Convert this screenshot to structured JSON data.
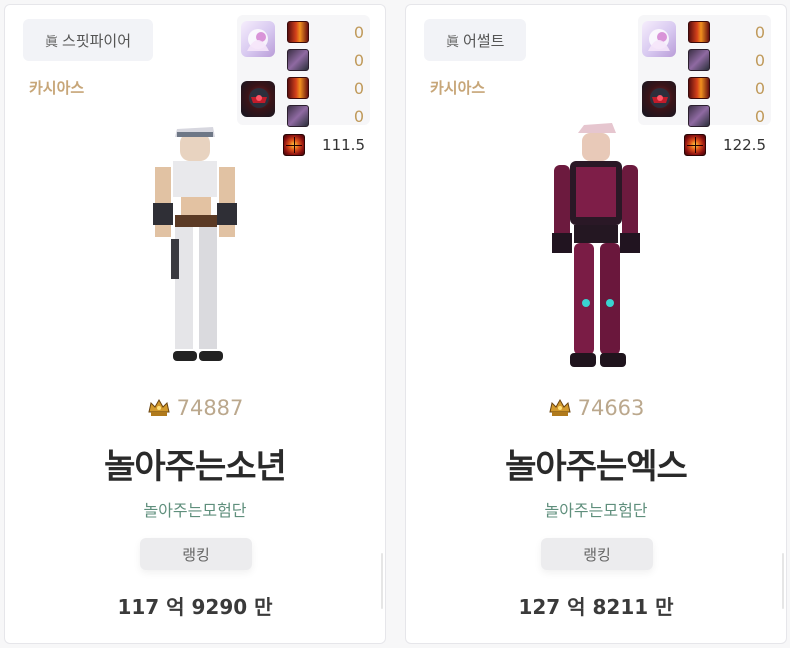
{
  "cards": [
    {
      "job_prefix": "眞",
      "job": "스핏파이어",
      "server": "카시아스",
      "buffs": [
        {
          "book": "book-icon",
          "value": "0"
        },
        {
          "char": "character-icon",
          "value": "0"
        },
        {
          "book": "book-icon",
          "value": "0"
        },
        {
          "char": "character-icon",
          "value": "0"
        }
      ],
      "buff_stat": "111.5",
      "fame": "74887",
      "name": "놀아주는소년",
      "guild": "놀아주는모험단",
      "rank_label": "랭킹",
      "rank_value": "117 억 9290 만"
    },
    {
      "job_prefix": "眞",
      "job": "어썰트",
      "server": "카시아스",
      "buffs": [
        {
          "book": "book-icon",
          "value": "0"
        },
        {
          "char": "character-icon",
          "value": "0"
        },
        {
          "book": "book-icon",
          "value": "0"
        },
        {
          "char": "character-icon",
          "value": "0"
        }
      ],
      "buff_stat": "122.5",
      "fame": "74663",
      "name": "놀아주는엑스",
      "guild": "놀아주는모험단",
      "rank_label": "랭킹",
      "rank_value": "127 억 8211 만"
    }
  ]
}
